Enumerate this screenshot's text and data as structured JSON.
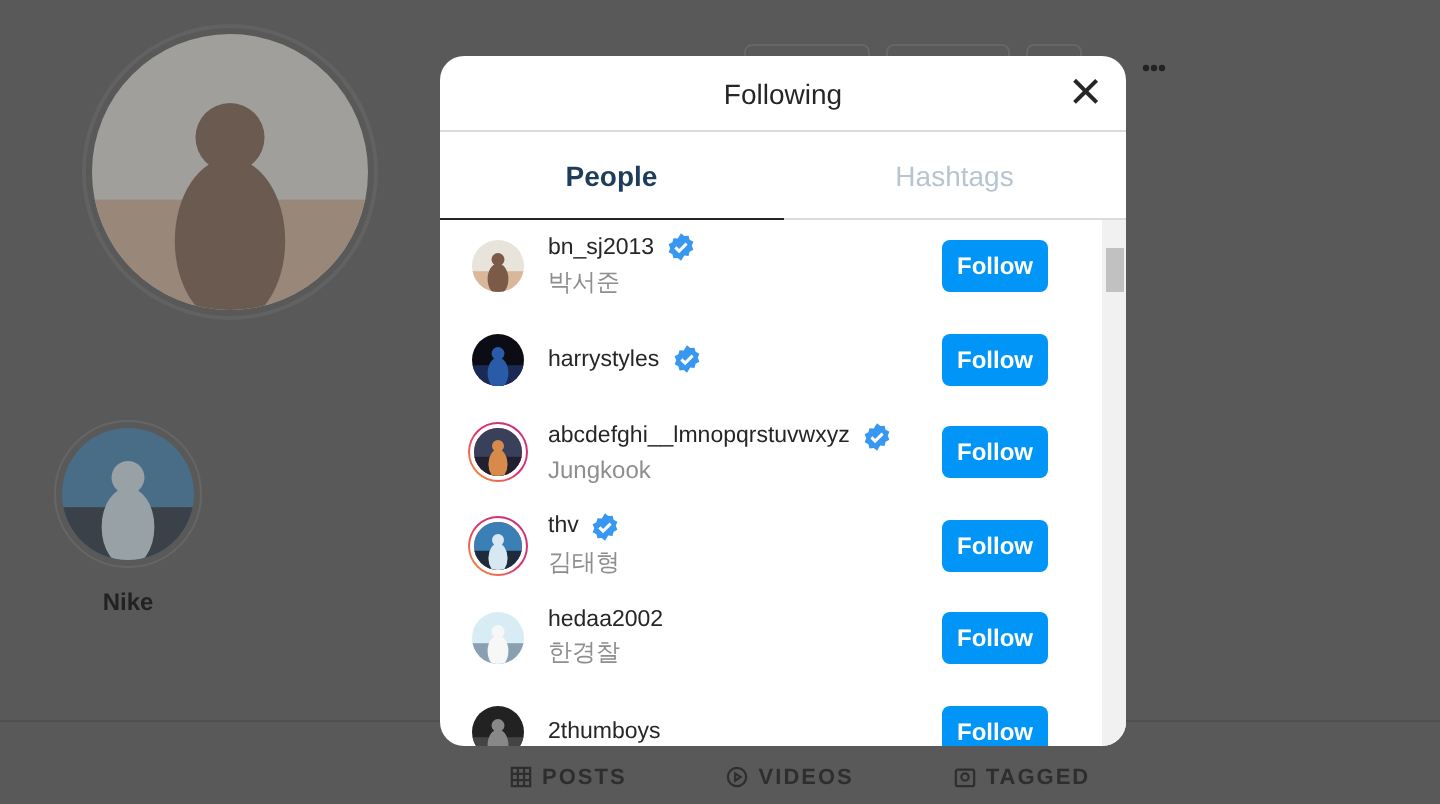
{
  "profile": {
    "highlights": [
      {
        "label": "Nike"
      }
    ]
  },
  "profile_tabs": [
    {
      "label": "POSTS",
      "kind": "grid"
    },
    {
      "label": "VIDEOS",
      "kind": "play"
    },
    {
      "label": "TAGGED",
      "kind": "tag"
    }
  ],
  "modal": {
    "title": "Following",
    "close": "×",
    "tabs": [
      {
        "label": "People",
        "selected": true
      },
      {
        "label": "Hashtags",
        "selected": false
      }
    ],
    "accounts": [
      {
        "username": "bn_sj2013",
        "name": "박서준",
        "verified": true,
        "story_ring": false,
        "button": "Follow"
      },
      {
        "username": "harrystyles",
        "verified": true,
        "story_ring": false,
        "button": "Follow"
      },
      {
        "username": "abcdefghi__lmnopqrstuvwxyz",
        "name": "Jungkook",
        "verified": true,
        "story_ring": true,
        "button": "Follow"
      },
      {
        "username": "thv",
        "name": "김태형",
        "verified": true,
        "story_ring": true,
        "button": "Follow"
      },
      {
        "username": "hedaa2002",
        "name": "한경찰",
        "verified": false,
        "story_ring": false,
        "button": "Follow"
      },
      {
        "username": "2thumboys",
        "verified": false,
        "story_ring": false,
        "button": "Follow"
      }
    ]
  }
}
